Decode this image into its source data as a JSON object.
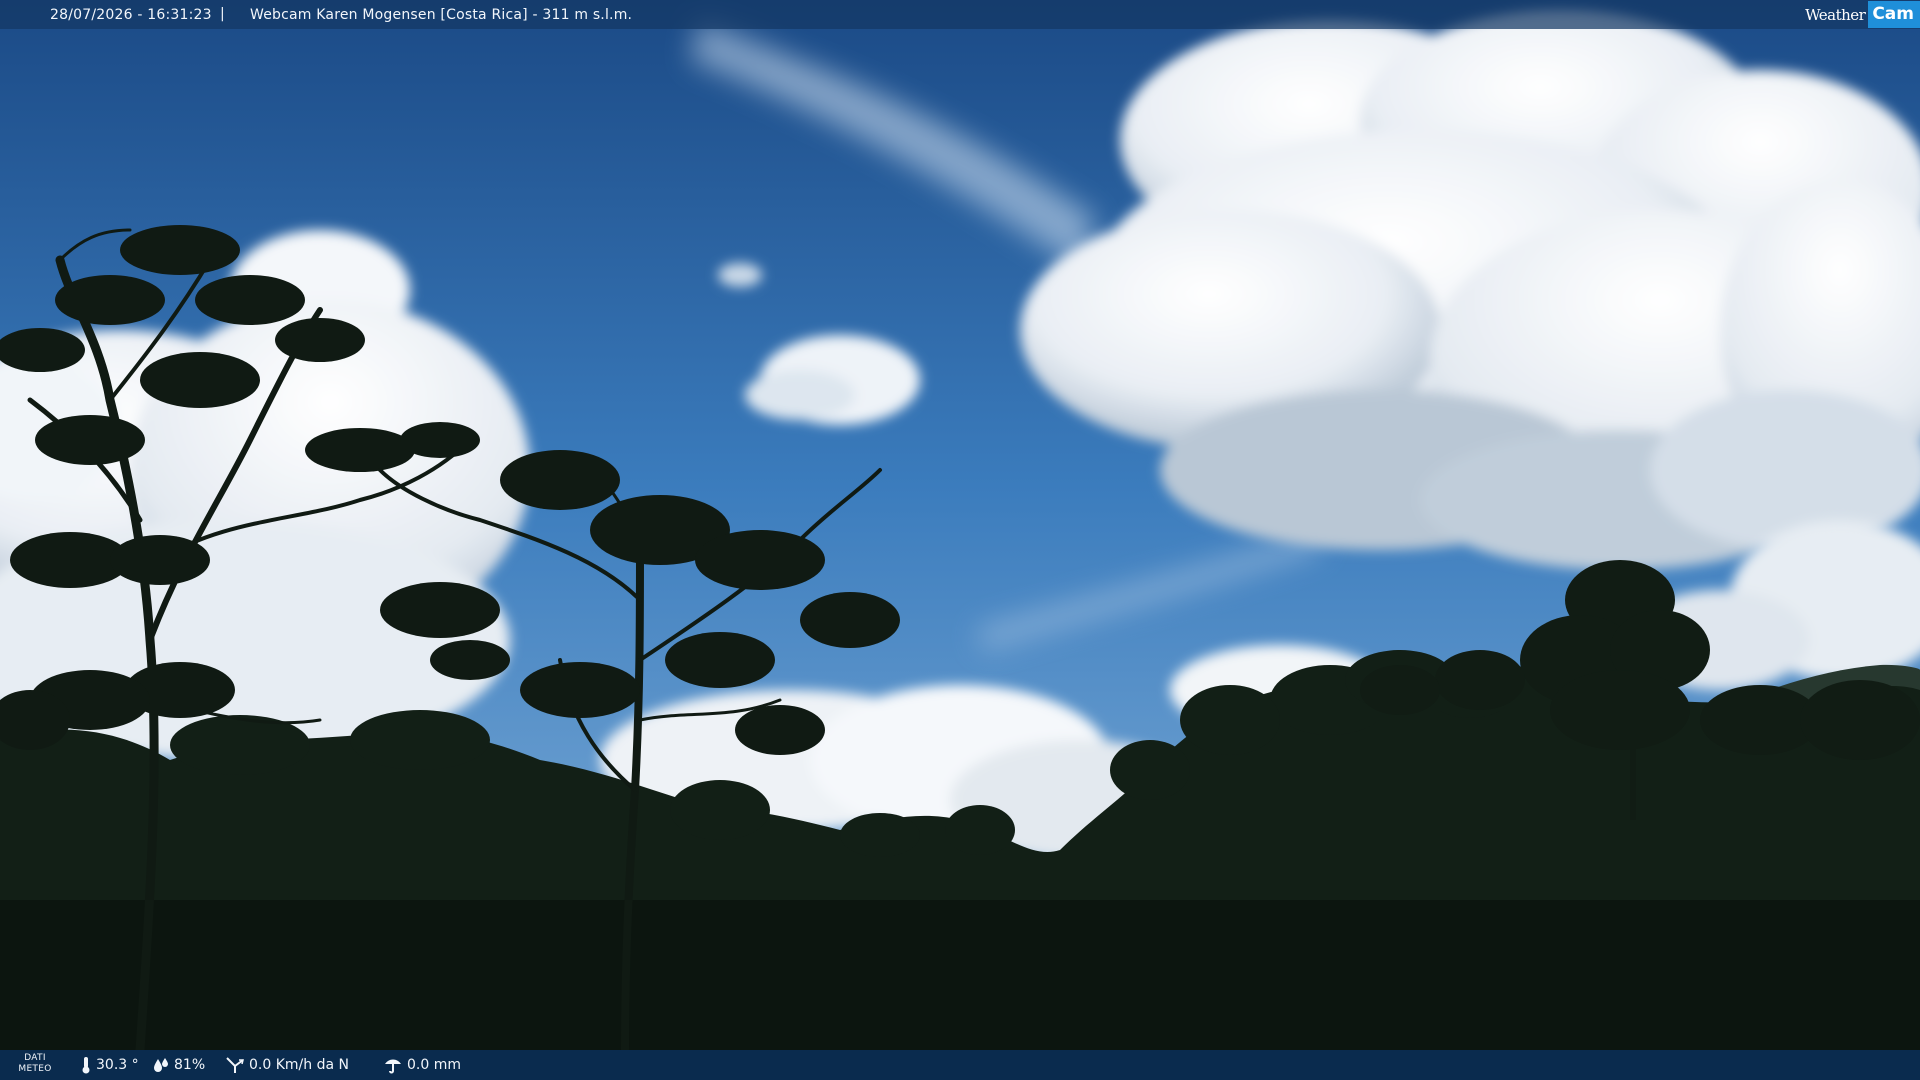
{
  "overlay": {
    "datetime": "28/07/2026 - 16:31:23",
    "separator": "|",
    "caption": "Webcam Karen Mogensen [Costa Rica]  - 311 m s.l.m."
  },
  "brand": {
    "part1": "Weather",
    "part2": "Cam",
    "accent_color": "#1f8fd9"
  },
  "meteo": {
    "label_line1": "DATI",
    "label_line2": "METEO",
    "temperature": "30.3 °",
    "humidity": "81%",
    "wind": "0.0 Km/h da N",
    "rain": "0.0 mm",
    "icons": [
      "thermometer-icon",
      "humidity-drops-icon",
      "wind-vane-icon",
      "rain-gauge-icon"
    ]
  },
  "scene_colors": {
    "sky_top": "#1e4f8c",
    "sky_mid": "#3e7fbf",
    "sky_low": "#6b9fd0",
    "cloud": "#ffffff",
    "cloud_shade": "#9fb3c8",
    "forest": "#0f1a12",
    "forest_far": "#1a2a1c"
  }
}
